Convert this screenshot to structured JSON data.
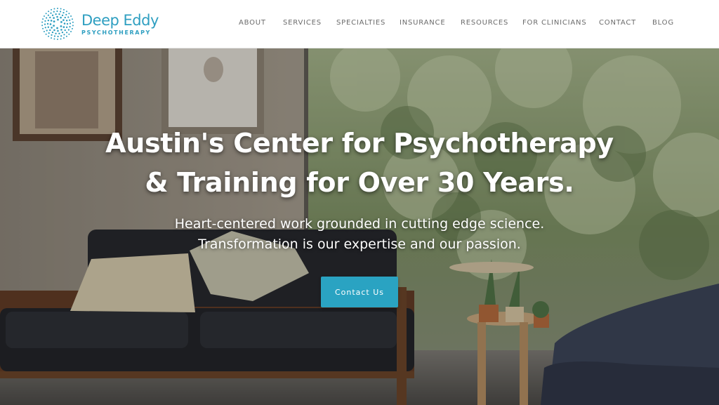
{
  "brand": {
    "name": "Deep Eddy",
    "tagline": "PSYCHOTHERAPY",
    "color": "#2f9fc1"
  },
  "nav": {
    "items": [
      {
        "label": "ABOUT"
      },
      {
        "label": "SERVICES"
      },
      {
        "label": "SPECIALTIES"
      },
      {
        "label": "INSURANCE"
      },
      {
        "label": "RESOURCES"
      },
      {
        "label": "FOR CLINICIANS"
      },
      {
        "label": "CONTACT"
      },
      {
        "label": "BLOG"
      }
    ]
  },
  "hero": {
    "title_line1": "Austin's Center for Psychotherapy",
    "title_line2": "& Training for Over 30 Years.",
    "subtitle_line1": "Heart-centered work grounded in cutting edge science.",
    "subtitle_line2": "Transformation is our expertise and our passion.",
    "cta_label": "Contact Us",
    "cta_color": "#2aa3c2"
  }
}
